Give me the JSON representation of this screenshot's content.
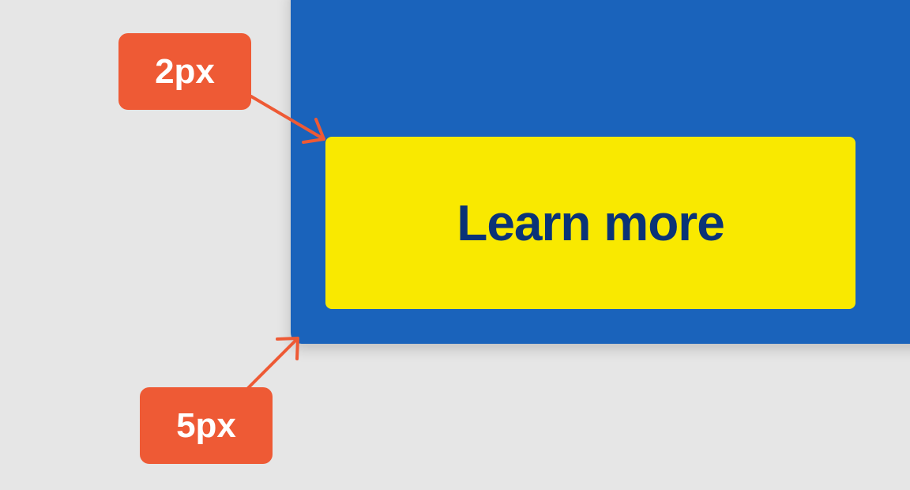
{
  "colors": {
    "background": "#e6e6e6",
    "card": "#1a63bb",
    "button_bg": "#f9e900",
    "button_text": "#0a3377",
    "annotation": "#ee5a35"
  },
  "button": {
    "label": "Learn more"
  },
  "annotations": [
    {
      "label": "2px",
      "points_to": "button-corner-radius"
    },
    {
      "label": "5px",
      "points_to": "card-corner-radius"
    }
  ],
  "icons": {
    "arrow": "arrow-icon"
  }
}
